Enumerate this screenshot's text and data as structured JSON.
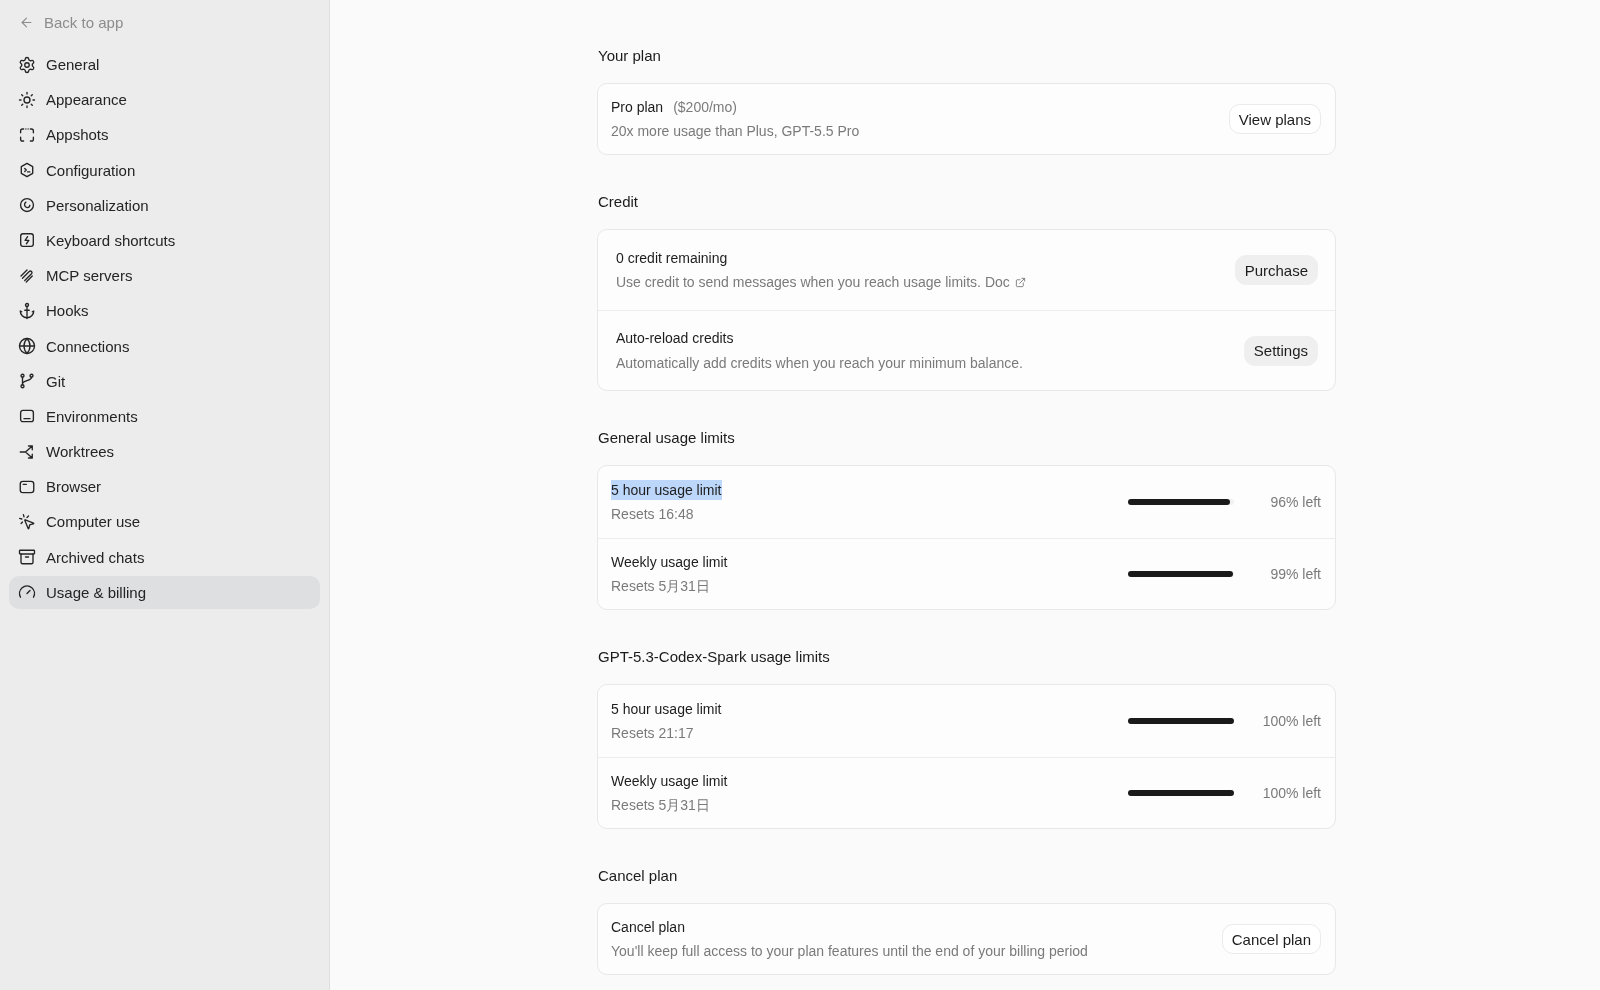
{
  "sidebar": {
    "back": "Back to app",
    "items": [
      {
        "label": "General",
        "selected": false
      },
      {
        "label": "Appearance",
        "selected": false
      },
      {
        "label": "Appshots",
        "selected": false
      },
      {
        "label": "Configuration",
        "selected": false
      },
      {
        "label": "Personalization",
        "selected": false
      },
      {
        "label": "Keyboard shortcuts",
        "selected": false
      },
      {
        "label": "MCP servers",
        "selected": false
      },
      {
        "label": "Hooks",
        "selected": false
      },
      {
        "label": "Connections",
        "selected": false
      },
      {
        "label": "Git",
        "selected": false
      },
      {
        "label": "Environments",
        "selected": false
      },
      {
        "label": "Worktrees",
        "selected": false
      },
      {
        "label": "Browser",
        "selected": false
      },
      {
        "label": "Computer use",
        "selected": false
      },
      {
        "label": "Archived chats",
        "selected": false
      },
      {
        "label": "Usage & billing",
        "selected": true
      }
    ]
  },
  "sections": [
    {
      "heading": "Your plan",
      "rows": [
        {
          "kind": "action",
          "title": "Pro plan",
          "note": "($200/mo)",
          "description": "20x more usage than Plus, GPT-5.5 Pro",
          "button": {
            "label": "View plans",
            "kind": "outline"
          }
        }
      ]
    },
    {
      "heading": "Credit",
      "rows": [
        {
          "kind": "action",
          "title": "0 credit remaining",
          "description": "Use credit to send messages when you reach usage limits.",
          "link": "Doc",
          "button": {
            "label": "Purchase",
            "kind": "soft"
          }
        },
        {
          "kind": "action",
          "title": "Auto-reload credits",
          "description": "Automatically add credits when you reach your minimum balance.",
          "button": {
            "label": "Settings",
            "kind": "soft"
          }
        }
      ]
    },
    {
      "heading": "General usage limits",
      "rows": [
        {
          "kind": "meter",
          "title": "5 hour usage limit",
          "highlighted": true,
          "description": "Resets 16:48",
          "level": 0.96,
          "reading": "96% left"
        },
        {
          "kind": "meter",
          "title": "Weekly usage limit",
          "highlighted": false,
          "description": "Resets 5月31日",
          "level": 0.99,
          "reading": "99% left"
        }
      ]
    },
    {
      "heading": "GPT-5.3-Codex-Spark usage limits",
      "rows": [
        {
          "kind": "meter",
          "title": "5 hour usage limit",
          "highlighted": false,
          "description": "Resets 21:17",
          "level": 1,
          "reading": "100% left"
        },
        {
          "kind": "meter",
          "title": "Weekly usage limit",
          "highlighted": false,
          "description": "Resets 5月31日",
          "level": 1,
          "reading": "100% left"
        }
      ]
    },
    {
      "heading": "Cancel plan",
      "rows": [
        {
          "kind": "action",
          "title": "Cancel plan",
          "description": "You'll keep full access to your plan features until the end of your billing period",
          "button": {
            "label": "Cancel plan",
            "kind": "outline"
          }
        }
      ]
    }
  ]
}
